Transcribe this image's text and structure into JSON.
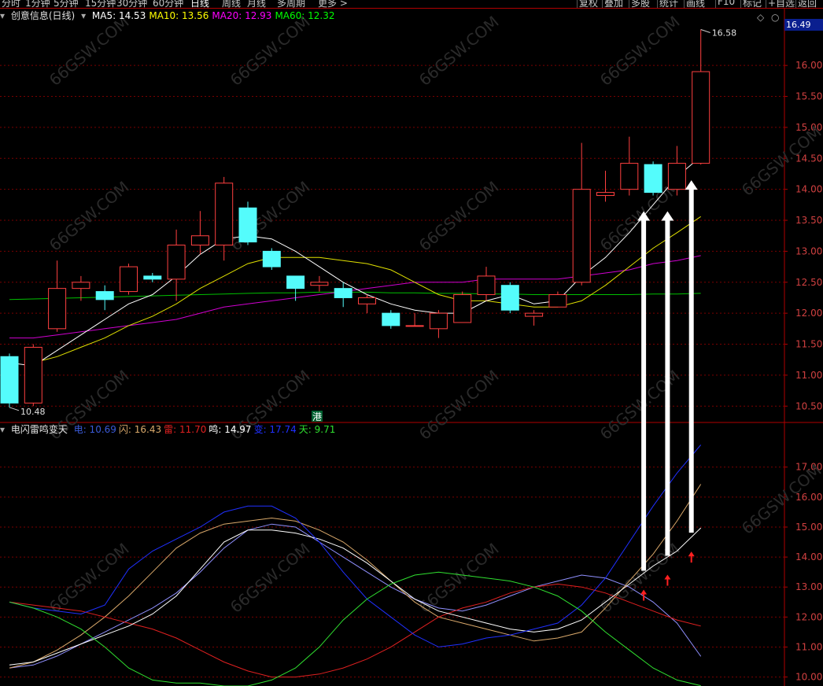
{
  "toolbar": {
    "tabs": [
      "分时",
      "1分钟",
      "5分钟",
      "15分钟",
      "30分钟",
      "60分钟",
      "日线",
      "周线",
      "月线",
      "多周期",
      "更多 >"
    ],
    "active_tab": "日线",
    "right_items": [
      "复权",
      "叠加",
      "多股",
      "统计",
      "画线",
      "F10",
      "标记",
      "+自选",
      "返回"
    ]
  },
  "price_panel": {
    "stock_name": "创意信息(日线)",
    "ma": [
      {
        "label": "MA5: 14.53",
        "color": "#ffffff"
      },
      {
        "label": "MA10: 13.56",
        "color": "#ffff00"
      },
      {
        "label": "MA20: 12.93",
        "color": "#ff00ff"
      },
      {
        "label": "MA60: 12.32",
        "color": "#00ff00"
      }
    ],
    "last_price": "16.49",
    "high_label": "16.58",
    "low_label": "10.48",
    "marker": "港"
  },
  "indicator_panel": {
    "name": "电闪雷鸣变天",
    "items": [
      {
        "label": "电: 10.69",
        "color": "#3a5ad8"
      },
      {
        "label": "闪: 16.43",
        "color": "#d9a86a"
      },
      {
        "label": "雷: 11.70",
        "color": "#e02020"
      },
      {
        "label": "鸣: 14.97",
        "color": "#ffffff"
      },
      {
        "label": "变: 17.74",
        "color": "#2030ff"
      },
      {
        "label": "天: 9.71",
        "color": "#30e030"
      }
    ]
  },
  "chart_data": [
    {
      "type": "candlestick",
      "y_ticks": [
        10.5,
        11.0,
        11.5,
        12.0,
        12.5,
        13.0,
        13.5,
        14.0,
        14.5,
        15.0,
        15.5,
        16.0
      ],
      "ylim": [
        10.3,
        16.65
      ],
      "candles": [
        {
          "o": 11.3,
          "c": 10.55,
          "h": 11.35,
          "l": 10.48
        },
        {
          "o": 10.55,
          "c": 11.45,
          "h": 11.5,
          "l": 10.5
        },
        {
          "o": 11.75,
          "c": 12.4,
          "h": 12.85,
          "l": 11.7
        },
        {
          "o": 12.4,
          "c": 12.5,
          "h": 12.6,
          "l": 12.2
        },
        {
          "o": 12.35,
          "c": 12.22,
          "h": 12.45,
          "l": 12.05
        },
        {
          "o": 12.35,
          "c": 12.75,
          "h": 12.8,
          "l": 12.3
        },
        {
          "o": 12.6,
          "c": 12.55,
          "h": 12.65,
          "l": 12.5
        },
        {
          "o": 12.55,
          "c": 13.1,
          "h": 13.35,
          "l": 12.2
        },
        {
          "o": 13.1,
          "c": 13.25,
          "h": 13.65,
          "l": 12.95
        },
        {
          "o": 13.1,
          "c": 14.1,
          "h": 14.2,
          "l": 12.85
        },
        {
          "o": 13.7,
          "c": 13.15,
          "h": 13.8,
          "l": 13.1
        },
        {
          "o": 13.0,
          "c": 12.75,
          "h": 13.05,
          "l": 12.7
        },
        {
          "o": 12.6,
          "c": 12.4,
          "h": 12.6,
          "l": 12.2
        },
        {
          "o": 12.45,
          "c": 12.5,
          "h": 12.6,
          "l": 12.35
        },
        {
          "o": 12.4,
          "c": 12.25,
          "h": 12.5,
          "l": 12.1
        },
        {
          "o": 12.15,
          "c": 12.25,
          "h": 12.3,
          "l": 12.0
        },
        {
          "o": 12.0,
          "c": 11.8,
          "h": 12.05,
          "l": 11.75
        },
        {
          "o": 11.8,
          "c": 11.8,
          "h": 12.0,
          "l": 11.8
        },
        {
          "o": 11.75,
          "c": 12.0,
          "h": 12.05,
          "l": 11.6
        },
        {
          "o": 11.85,
          "c": 12.3,
          "h": 12.35,
          "l": 11.85
        },
        {
          "o": 12.3,
          "c": 12.6,
          "h": 12.75,
          "l": 12.2
        },
        {
          "o": 12.45,
          "c": 12.05,
          "h": 12.5,
          "l": 12.0
        },
        {
          "o": 11.95,
          "c": 12.0,
          "h": 12.05,
          "l": 11.8
        },
        {
          "o": 12.1,
          "c": 12.3,
          "h": 12.35,
          "l": 12.1
        },
        {
          "o": 12.5,
          "c": 14.0,
          "h": 14.75,
          "l": 12.45
        },
        {
          "o": 13.9,
          "c": 13.95,
          "h": 14.3,
          "l": 13.8
        },
        {
          "o": 14.0,
          "c": 14.42,
          "h": 14.85,
          "l": 13.9
        },
        {
          "o": 14.4,
          "c": 13.95,
          "h": 14.45,
          "l": 13.9
        },
        {
          "o": 14.0,
          "c": 14.42,
          "h": 14.7,
          "l": 13.9
        },
        {
          "o": 14.42,
          "c": 15.9,
          "h": 16.58,
          "l": 14.4
        }
      ],
      "ma5": [
        11.2,
        11.15,
        11.4,
        11.65,
        11.9,
        12.15,
        12.3,
        12.6,
        12.95,
        13.2,
        13.25,
        13.2,
        13.0,
        12.75,
        12.5,
        12.3,
        12.15,
        12.05,
        12.0,
        12.0,
        12.2,
        12.3,
        12.15,
        12.2,
        12.6,
        12.9,
        13.3,
        13.75,
        14.2,
        14.53
      ],
      "ma10": [
        null,
        11.2,
        11.3,
        11.45,
        11.6,
        11.8,
        11.95,
        12.15,
        12.4,
        12.6,
        12.8,
        12.9,
        12.9,
        12.9,
        12.85,
        12.8,
        12.7,
        12.5,
        12.3,
        12.2,
        12.2,
        12.15,
        12.1,
        12.1,
        12.2,
        12.45,
        12.75,
        13.05,
        13.3,
        13.56
      ],
      "ma20": [
        11.6,
        11.6,
        11.65,
        11.7,
        11.75,
        11.8,
        11.85,
        11.9,
        12.0,
        12.1,
        12.15,
        12.2,
        12.25,
        12.3,
        12.35,
        12.4,
        12.45,
        12.5,
        12.5,
        12.5,
        12.55,
        12.55,
        12.55,
        12.55,
        12.6,
        12.65,
        12.7,
        12.8,
        12.85,
        12.93
      ],
      "ma60": [
        12.22,
        12.23,
        12.24,
        12.25,
        12.26,
        12.27,
        12.28,
        12.29,
        12.3,
        12.31,
        12.32,
        12.33,
        12.33,
        12.34,
        12.34,
        12.34,
        12.33,
        12.33,
        12.32,
        12.32,
        12.31,
        12.31,
        12.3,
        12.3,
        12.3,
        12.3,
        12.3,
        12.31,
        12.31,
        12.32
      ]
    },
    {
      "type": "line",
      "y_ticks": [
        10.0,
        11.0,
        12.0,
        13.0,
        14.0,
        15.0,
        16.0,
        17.0
      ],
      "ylim": [
        9.7,
        18.2
      ],
      "series": [
        {
          "name": "电",
          "color": "#9090ff",
          "values": [
            10.3,
            10.4,
            10.7,
            11.1,
            11.5,
            11.9,
            12.3,
            12.8,
            13.5,
            14.3,
            14.9,
            15.1,
            15.0,
            14.5,
            14.0,
            13.5,
            13.0,
            12.6,
            12.3,
            12.2,
            12.4,
            12.7,
            13.0,
            13.2,
            13.4,
            13.3,
            13.0,
            12.5,
            11.8,
            10.69
          ]
        },
        {
          "name": "闪",
          "color": "#d9a86a",
          "values": [
            10.3,
            10.5,
            10.9,
            11.4,
            12.0,
            12.7,
            13.5,
            14.3,
            14.8,
            15.1,
            15.2,
            15.3,
            15.2,
            14.9,
            14.5,
            13.9,
            13.2,
            12.5,
            12.0,
            11.8,
            11.6,
            11.4,
            11.2,
            11.3,
            11.5,
            12.3,
            13.2,
            14.1,
            15.2,
            16.43
          ]
        },
        {
          "name": "雷",
          "color": "#e02020",
          "values": [
            12.5,
            12.4,
            12.3,
            12.2,
            12.0,
            11.8,
            11.6,
            11.3,
            10.9,
            10.5,
            10.2,
            10.0,
            10.0,
            10.1,
            10.3,
            10.6,
            11.0,
            11.5,
            12.0,
            12.3,
            12.5,
            12.8,
            13.0,
            13.1,
            13.0,
            12.8,
            12.5,
            12.2,
            11.9,
            11.7
          ]
        },
        {
          "name": "鸣",
          "color": "#ffffff",
          "values": [
            10.4,
            10.5,
            10.8,
            11.1,
            11.4,
            11.7,
            12.1,
            12.7,
            13.6,
            14.5,
            14.9,
            14.9,
            14.8,
            14.6,
            14.3,
            13.8,
            13.2,
            12.6,
            12.2,
            12.0,
            11.8,
            11.6,
            11.5,
            11.6,
            11.9,
            12.5,
            13.1,
            13.7,
            14.2,
            14.97
          ]
        },
        {
          "name": "变",
          "color": "#2030ff",
          "values": [
            12.5,
            12.3,
            12.2,
            12.1,
            12.4,
            13.6,
            14.2,
            14.6,
            15.0,
            15.5,
            15.7,
            15.7,
            15.3,
            14.5,
            13.5,
            12.6,
            12.0,
            11.4,
            11.0,
            11.1,
            11.3,
            11.4,
            11.6,
            11.8,
            12.4,
            13.3,
            14.5,
            15.7,
            16.8,
            17.74
          ]
        },
        {
          "name": "天",
          "color": "#30e030",
          "values": [
            12.5,
            12.3,
            12.0,
            11.6,
            11.0,
            10.3,
            9.9,
            9.8,
            9.8,
            9.7,
            9.7,
            9.9,
            10.3,
            11.0,
            11.9,
            12.6,
            13.1,
            13.4,
            13.5,
            13.4,
            13.3,
            13.2,
            13.0,
            12.7,
            12.2,
            11.5,
            10.9,
            10.3,
            9.9,
            9.71
          ]
        }
      ]
    }
  ]
}
